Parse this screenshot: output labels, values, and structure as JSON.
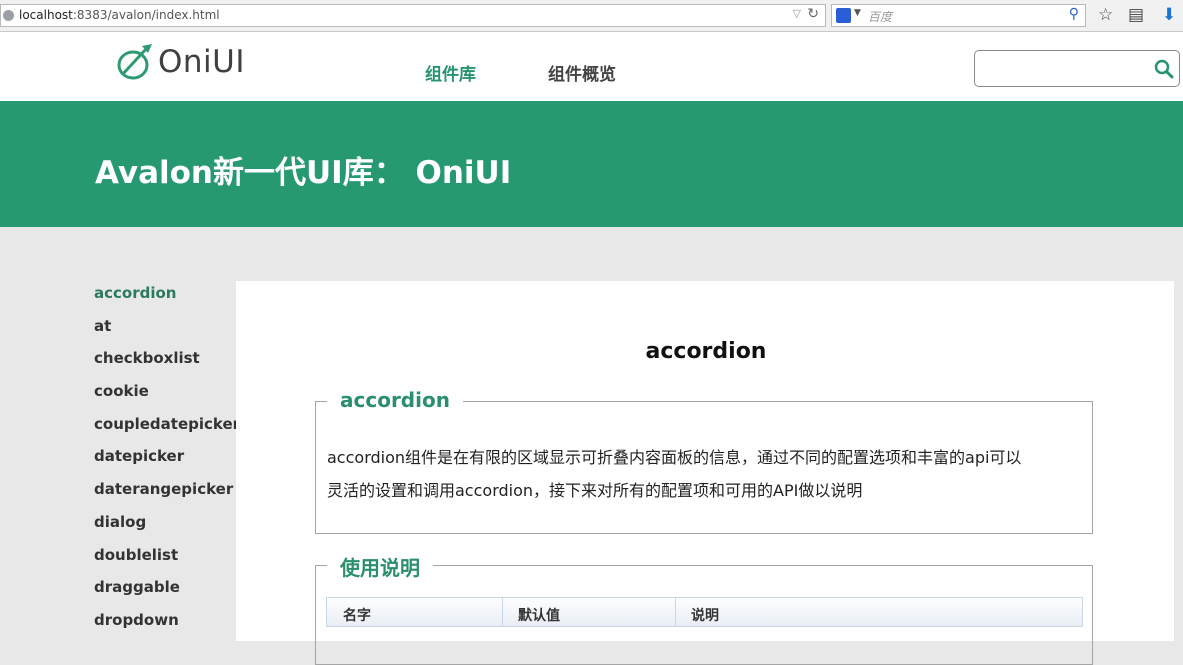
{
  "browser": {
    "url_host": "localhost",
    "url_rest": ":8383/avalon/index.html",
    "search_placeholder": "百度"
  },
  "header": {
    "logo_text": "OniUI",
    "nav": [
      {
        "label": "组件库",
        "active": true
      },
      {
        "label": "组件概览",
        "active": false
      }
    ],
    "search_value": ""
  },
  "banner": {
    "title": "Avalon新一代UI库： OniUI"
  },
  "sidebar": {
    "items": [
      {
        "label": "accordion",
        "active": true
      },
      {
        "label": "at"
      },
      {
        "label": "checkboxlist"
      },
      {
        "label": "cookie"
      },
      {
        "label": "coupledatepicker"
      },
      {
        "label": "datepicker"
      },
      {
        "label": "daterangepicker"
      },
      {
        "label": "dialog"
      },
      {
        "label": "doublelist"
      },
      {
        "label": "draggable"
      },
      {
        "label": "dropdown"
      }
    ]
  },
  "main": {
    "title": "accordion",
    "section1": {
      "legend": "accordion",
      "line1": "accordion组件是在有限的区域显示可折叠内容面板的信息，通过不同的配置选项和丰富的api可以",
      "line2": "灵活的设置和调用accordion，接下来对所有的配置项和可用的API做以说明"
    },
    "section2": {
      "legend": "使用说明",
      "columns": [
        "名字",
        "默认值",
        "说明"
      ]
    }
  },
  "colors": {
    "brand_green": "#279970",
    "active_text": "#2b7a60"
  }
}
